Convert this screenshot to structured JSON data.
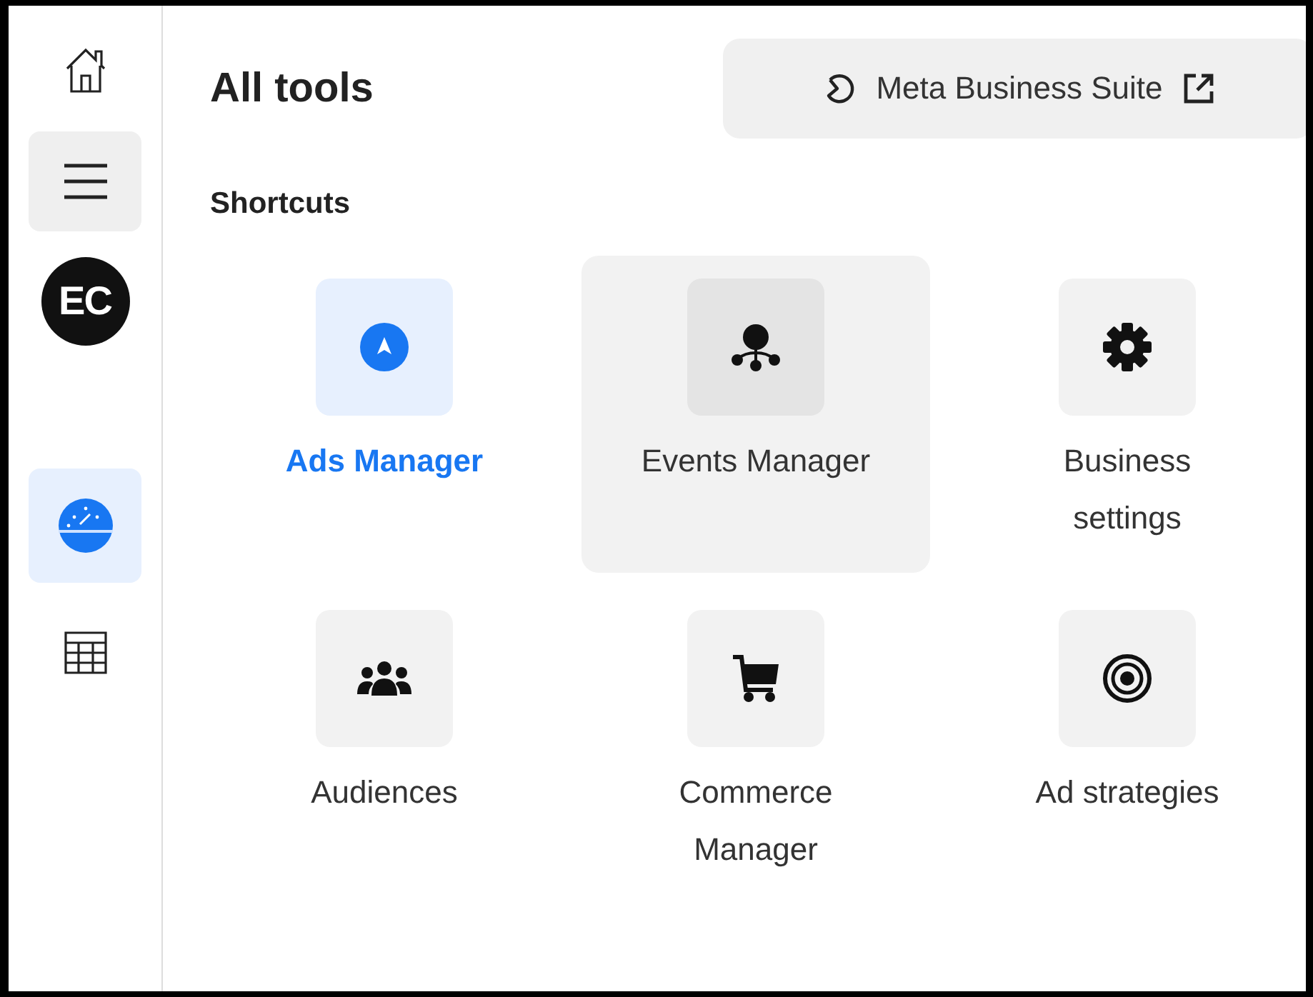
{
  "sidebar": {
    "items": [
      {
        "kind": "home",
        "selected": false,
        "hovered": false
      },
      {
        "kind": "menu",
        "selected": false,
        "hovered": true
      },
      {
        "kind": "avatar",
        "label": "EC",
        "selected": false,
        "hovered": false
      },
      {
        "kind": "dashboard",
        "selected": true,
        "hovered": false
      },
      {
        "kind": "table",
        "selected": false,
        "hovered": false
      }
    ]
  },
  "title": "All tools",
  "suite_button": {
    "label": "Meta Business Suite"
  },
  "section": "Shortcuts",
  "tools": [
    {
      "kind": "ads",
      "label": "Ads Manager",
      "selected": true,
      "hovered": false
    },
    {
      "kind": "events",
      "label": "Events Manager",
      "selected": false,
      "hovered": true
    },
    {
      "kind": "settings",
      "label": "Business settings",
      "selected": false,
      "hovered": false
    },
    {
      "kind": "audiences",
      "label": "Audiences",
      "selected": false,
      "hovered": false
    },
    {
      "kind": "commerce",
      "label": "Commerce Manager",
      "selected": false,
      "hovered": false
    },
    {
      "kind": "strategies",
      "label": "Ad strategies",
      "selected": false,
      "hovered": false
    }
  ]
}
